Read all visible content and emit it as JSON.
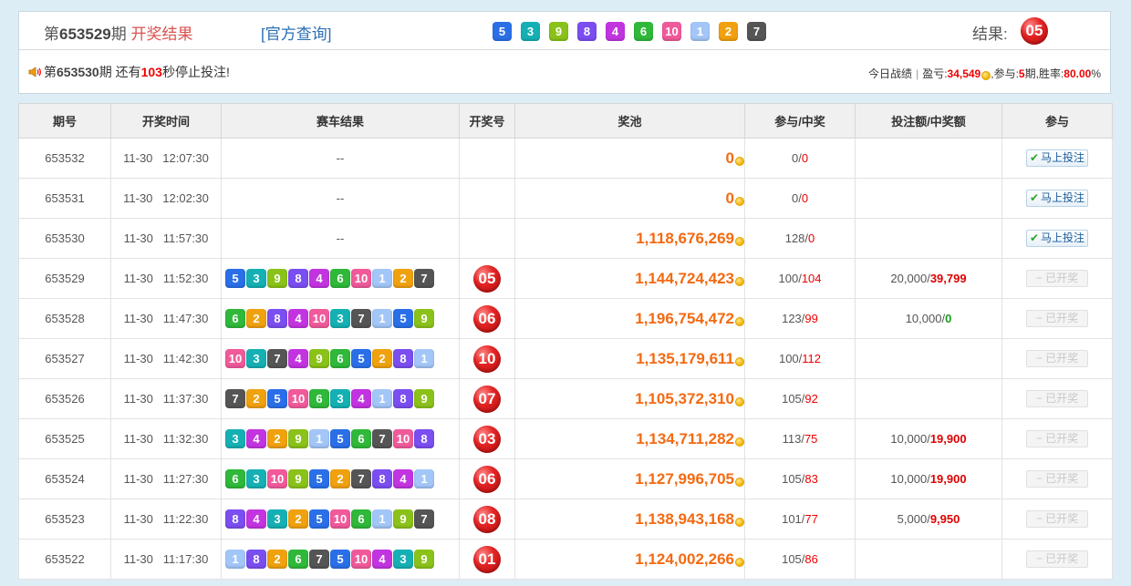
{
  "panel": {
    "title_prefix": "第",
    "title_period": "653529",
    "title_suffix": "期",
    "title_status": "开奖结果",
    "query_link": "[官方查询]",
    "balls": [
      5,
      3,
      9,
      8,
      4,
      6,
      10,
      1,
      2,
      7
    ],
    "result_label": "结果:",
    "result": "05",
    "countdown_prefix": "第",
    "countdown_period": "653530",
    "countdown_mid": "期 还有",
    "countdown_secs": "103",
    "countdown_suffix": "秒停止投注!",
    "stats_label": "今日战绩",
    "stats_profit_label": "盈亏:",
    "stats_profit": "34,549",
    "stats_join_label": "参与:",
    "stats_join": "5",
    "stats_join_unit": "期,",
    "stats_rate_label": "胜率:",
    "stats_rate": "80.00",
    "stats_rate_unit": "%"
  },
  "table": {
    "headers": [
      "期号",
      "开奖时间",
      "赛车结果",
      "开奖号",
      "奖池",
      "参与/中奖",
      "投注额/中奖额",
      "参与"
    ],
    "bet_label": "马上投注",
    "drawn_label": "已开奖",
    "rows": [
      {
        "id": "653532",
        "date": "11-30",
        "time": "12:07:30",
        "balls": [],
        "result": "",
        "pool": "0",
        "join": "0",
        "win": "0",
        "bet": "",
        "prize": "",
        "state": "open"
      },
      {
        "id": "653531",
        "date": "11-30",
        "time": "12:02:30",
        "balls": [],
        "result": "",
        "pool": "0",
        "join": "0",
        "win": "0",
        "bet": "",
        "prize": "",
        "state": "open"
      },
      {
        "id": "653530",
        "date": "11-30",
        "time": "11:57:30",
        "balls": [],
        "result": "",
        "pool": "1,118,676,269",
        "join": "128",
        "win": "0",
        "bet": "",
        "prize": "",
        "state": "open"
      },
      {
        "id": "653529",
        "date": "11-30",
        "time": "11:52:30",
        "balls": [
          5,
          3,
          9,
          8,
          4,
          6,
          10,
          1,
          2,
          7
        ],
        "result": "05",
        "pool": "1,144,724,423",
        "join": "100",
        "win": "104",
        "bet": "20,000",
        "prize": "39,799",
        "state": "done"
      },
      {
        "id": "653528",
        "date": "11-30",
        "time": "11:47:30",
        "balls": [
          6,
          2,
          8,
          4,
          10,
          3,
          7,
          1,
          5,
          9
        ],
        "result": "06",
        "pool": "1,196,754,472",
        "join": "123",
        "win": "99",
        "bet": "10,000",
        "prize": "0",
        "state": "done"
      },
      {
        "id": "653527",
        "date": "11-30",
        "time": "11:42:30",
        "balls": [
          10,
          3,
          7,
          4,
          9,
          6,
          5,
          2,
          8,
          1
        ],
        "result": "10",
        "pool": "1,135,179,611",
        "join": "100",
        "win": "112",
        "bet": "",
        "prize": "",
        "state": "done"
      },
      {
        "id": "653526",
        "date": "11-30",
        "time": "11:37:30",
        "balls": [
          7,
          2,
          5,
          10,
          6,
          3,
          4,
          1,
          8,
          9
        ],
        "result": "07",
        "pool": "1,105,372,310",
        "join": "105",
        "win": "92",
        "bet": "",
        "prize": "",
        "state": "done"
      },
      {
        "id": "653525",
        "date": "11-30",
        "time": "11:32:30",
        "balls": [
          3,
          4,
          2,
          9,
          1,
          5,
          6,
          7,
          10,
          8
        ],
        "result": "03",
        "pool": "1,134,711,282",
        "join": "113",
        "win": "75",
        "bet": "10,000",
        "prize": "19,900",
        "state": "done"
      },
      {
        "id": "653524",
        "date": "11-30",
        "time": "11:27:30",
        "balls": [
          6,
          3,
          10,
          9,
          5,
          2,
          7,
          8,
          4,
          1
        ],
        "result": "06",
        "pool": "1,127,996,705",
        "join": "105",
        "win": "83",
        "bet": "10,000",
        "prize": "19,900",
        "state": "done"
      },
      {
        "id": "653523",
        "date": "11-30",
        "time": "11:22:30",
        "balls": [
          8,
          4,
          3,
          2,
          5,
          10,
          6,
          1,
          9,
          7
        ],
        "result": "08",
        "pool": "1,138,943,168",
        "join": "101",
        "win": "77",
        "bet": "5,000",
        "prize": "9,950",
        "state": "done"
      },
      {
        "id": "653522",
        "date": "11-30",
        "time": "11:17:30",
        "balls": [
          1,
          8,
          2,
          6,
          7,
          5,
          10,
          4,
          3,
          9
        ],
        "result": "01",
        "pool": "1,124,002,266",
        "join": "105",
        "win": "86",
        "bet": "",
        "prize": "",
        "state": "done"
      }
    ],
    "empty_mark": "--",
    "colors": {
      "1": "#a3c6f8",
      "2": "#f0a10e",
      "3": "#15b0b4",
      "4": "#c234e0",
      "5": "#2a6fe8",
      "6": "#2fb83a",
      "7": "#555555",
      "8": "#7a4ef0",
      "9": "#8bc21a",
      "10": "#f05a9a"
    }
  }
}
